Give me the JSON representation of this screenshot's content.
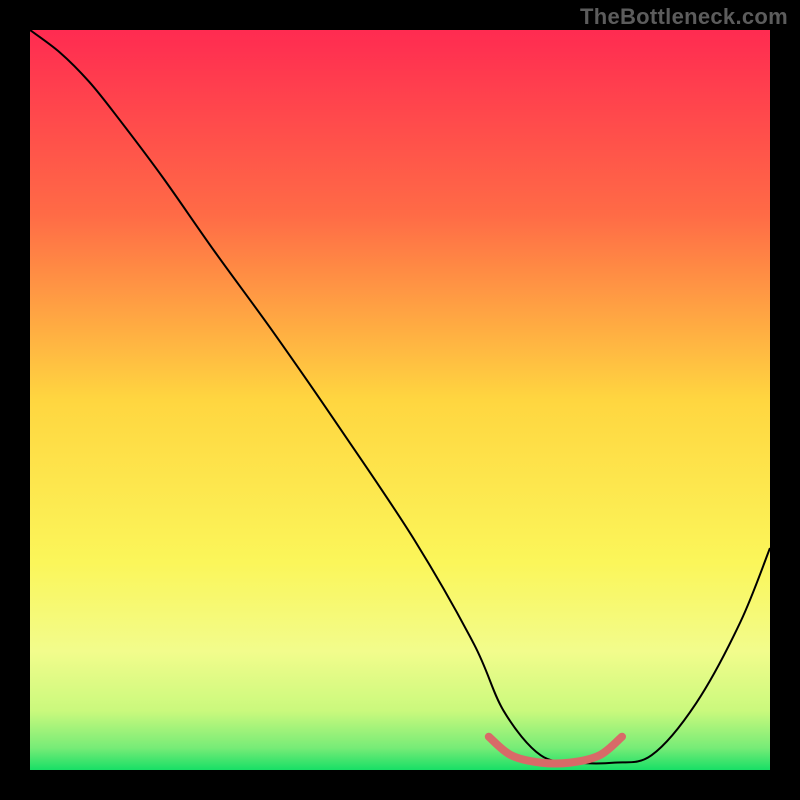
{
  "watermark": "TheBottleneck.com",
  "chart_data": {
    "type": "line",
    "title": "",
    "xlabel": "",
    "ylabel": "",
    "xlim": [
      0,
      100
    ],
    "ylim": [
      0,
      100
    ],
    "legend": false,
    "grid": false,
    "background_gradient": {
      "stops": [
        {
          "offset": 0,
          "color": "#ff2b51"
        },
        {
          "offset": 25,
          "color": "#ff6b46"
        },
        {
          "offset": 50,
          "color": "#ffd640"
        },
        {
          "offset": 72,
          "color": "#fbf65a"
        },
        {
          "offset": 84,
          "color": "#f2fc8c"
        },
        {
          "offset": 92,
          "color": "#caf97d"
        },
        {
          "offset": 97,
          "color": "#77ec77"
        },
        {
          "offset": 100,
          "color": "#18df66"
        }
      ]
    },
    "series": [
      {
        "name": "bottleneck-curve",
        "color": "#000000",
        "width": 2,
        "x": [
          0,
          4,
          8,
          12,
          18,
          25,
          33,
          42,
          52,
          60,
          64,
          69,
          74,
          79,
          84,
          90,
          96,
          100
        ],
        "y": [
          100,
          97,
          93,
          88,
          80,
          70,
          59,
          46,
          31,
          17,
          8,
          2,
          1,
          1,
          2,
          9,
          20,
          30
        ]
      },
      {
        "name": "optimal-range",
        "color": "#d86a68",
        "width": 8,
        "x": [
          62,
          65,
          69,
          73,
          77,
          80
        ],
        "y": [
          4.5,
          2,
          1,
          1,
          2,
          4.5
        ]
      }
    ]
  }
}
